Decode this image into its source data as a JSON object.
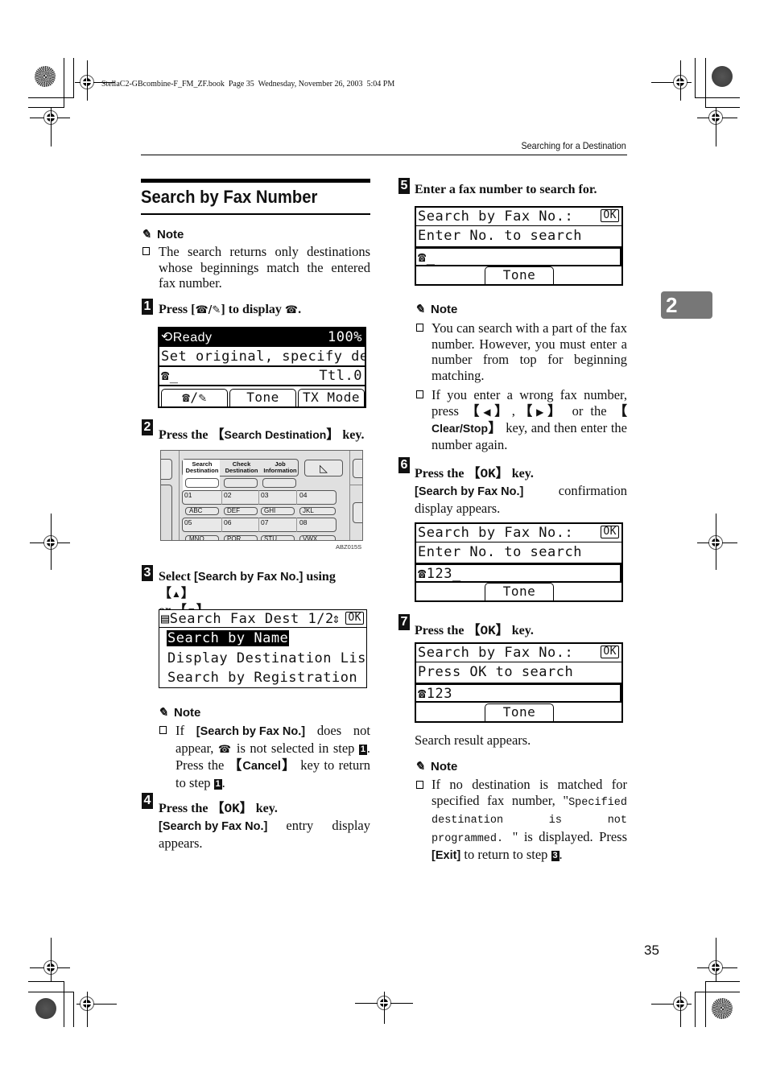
{
  "file_header": "StellaC2-GBcombine-F_FM_ZF.book  Page 35  Wednesday, November 26, 2003  5:04 PM",
  "running_header": "Searching for a Destination",
  "chapter_tab": "2",
  "page_number": "35",
  "section_title": "Search by Fax Number",
  "note_label": "Note",
  "intro_note": "The search returns only destinations whose beginnings match the entered fax number.",
  "steps": {
    "s1": {
      "num": "1",
      "text_a": "Press [",
      "text_b": "] to display ",
      "text_c": "."
    },
    "s2": {
      "num": "2",
      "text_a": "Press the ",
      "key": "Search Destination",
      "text_b": " key."
    },
    "s3": {
      "num": "3",
      "text_a": "Select ",
      "key": "[Search by Fax No.]",
      "text_b": " using ",
      "up": "▲",
      "text_c": "or ",
      "down": "▼",
      "text_d": "."
    },
    "s4": {
      "num": "4",
      "text_a": "Press the ",
      "key": "OK",
      "text_b": " key.",
      "sub_key": "[Search by Fax No.]",
      "sub_text": " entry display appears."
    },
    "s5": {
      "num": "5",
      "text": "Enter a fax number to search for."
    },
    "s6": {
      "num": "6",
      "text_a": "Press the ",
      "key": "OK",
      "text_b": " key.",
      "sub_key": "[Search by Fax No.]",
      "sub_text": " confirmation display appears."
    },
    "s7": {
      "num": "7",
      "text_a": "Press the ",
      "key": "OK",
      "text_b": " key.",
      "sub_text": "Search result appears."
    }
  },
  "note3": {
    "a": "If ",
    "key": "[Search by Fax No.]",
    "b": " does not appear, ",
    "c": " is not selected in step ",
    "d": ". Press the ",
    "cancel": "Cancel",
    "e": " key to return to step ",
    "f": "."
  },
  "note5": {
    "item1": "You can search with a part of the fax number. However, you must enter a number from top for beginning matching.",
    "item2_a": "If you enter a wrong fax number, press ",
    "left": "◀",
    "right": "▶",
    "item2_b": " or the ",
    "clear": "Clear/Stop",
    "item2_c": " key, and then enter the number again."
  },
  "note7": {
    "a": "If no destination is matched for specified fax number, \"",
    "mono": "Specified destination is not programmed. ",
    "b": "\" is displayed. Press ",
    "exit": "[Exit]",
    "c": " to return to step ",
    "d": "."
  },
  "lcd1": {
    "status": "Ready",
    "zoom": "100%",
    "line2": "Set original, specify dest.",
    "line3_cursor": "_",
    "total": "Ttl.0",
    "tabs": [
      "Tone",
      "TX Mode"
    ]
  },
  "lcd3": {
    "title": "Search Fax Dest 1/2",
    "ok": "OK",
    "items": [
      "Search by Name",
      "Display Destination List",
      "Search by Registration No."
    ],
    "selected_index": 0
  },
  "lcd5": {
    "title": "Search by Fax No.:",
    "ok": "OK",
    "line2": "Enter No. to search",
    "entry": "_",
    "tab": "Tone"
  },
  "lcd6": {
    "title": "Search by Fax No.:",
    "ok": "OK",
    "line2": "Enter No. to search",
    "entry": "123_",
    "tab": "Tone"
  },
  "lcd7": {
    "title": "Search by Fax No.:",
    "ok": "OK",
    "line2": "Press OK to search",
    "entry": "123",
    "tab": "Tone"
  },
  "control_panel": {
    "tabs": [
      [
        "Search",
        "Destination"
      ],
      [
        "Check",
        "Destination"
      ],
      [
        "Job",
        "Information"
      ]
    ],
    "keys_row1": [
      "01",
      "02",
      "03",
      "04"
    ],
    "letters_row1": [
      "ABC",
      "DEF",
      "GHI",
      "JKL"
    ],
    "keys_row2": [
      "05",
      "06",
      "07",
      "08"
    ],
    "letters_row2": [
      "MNO",
      "PQR",
      "STU",
      "VWX"
    ],
    "figure_id": "ABZ015S"
  }
}
